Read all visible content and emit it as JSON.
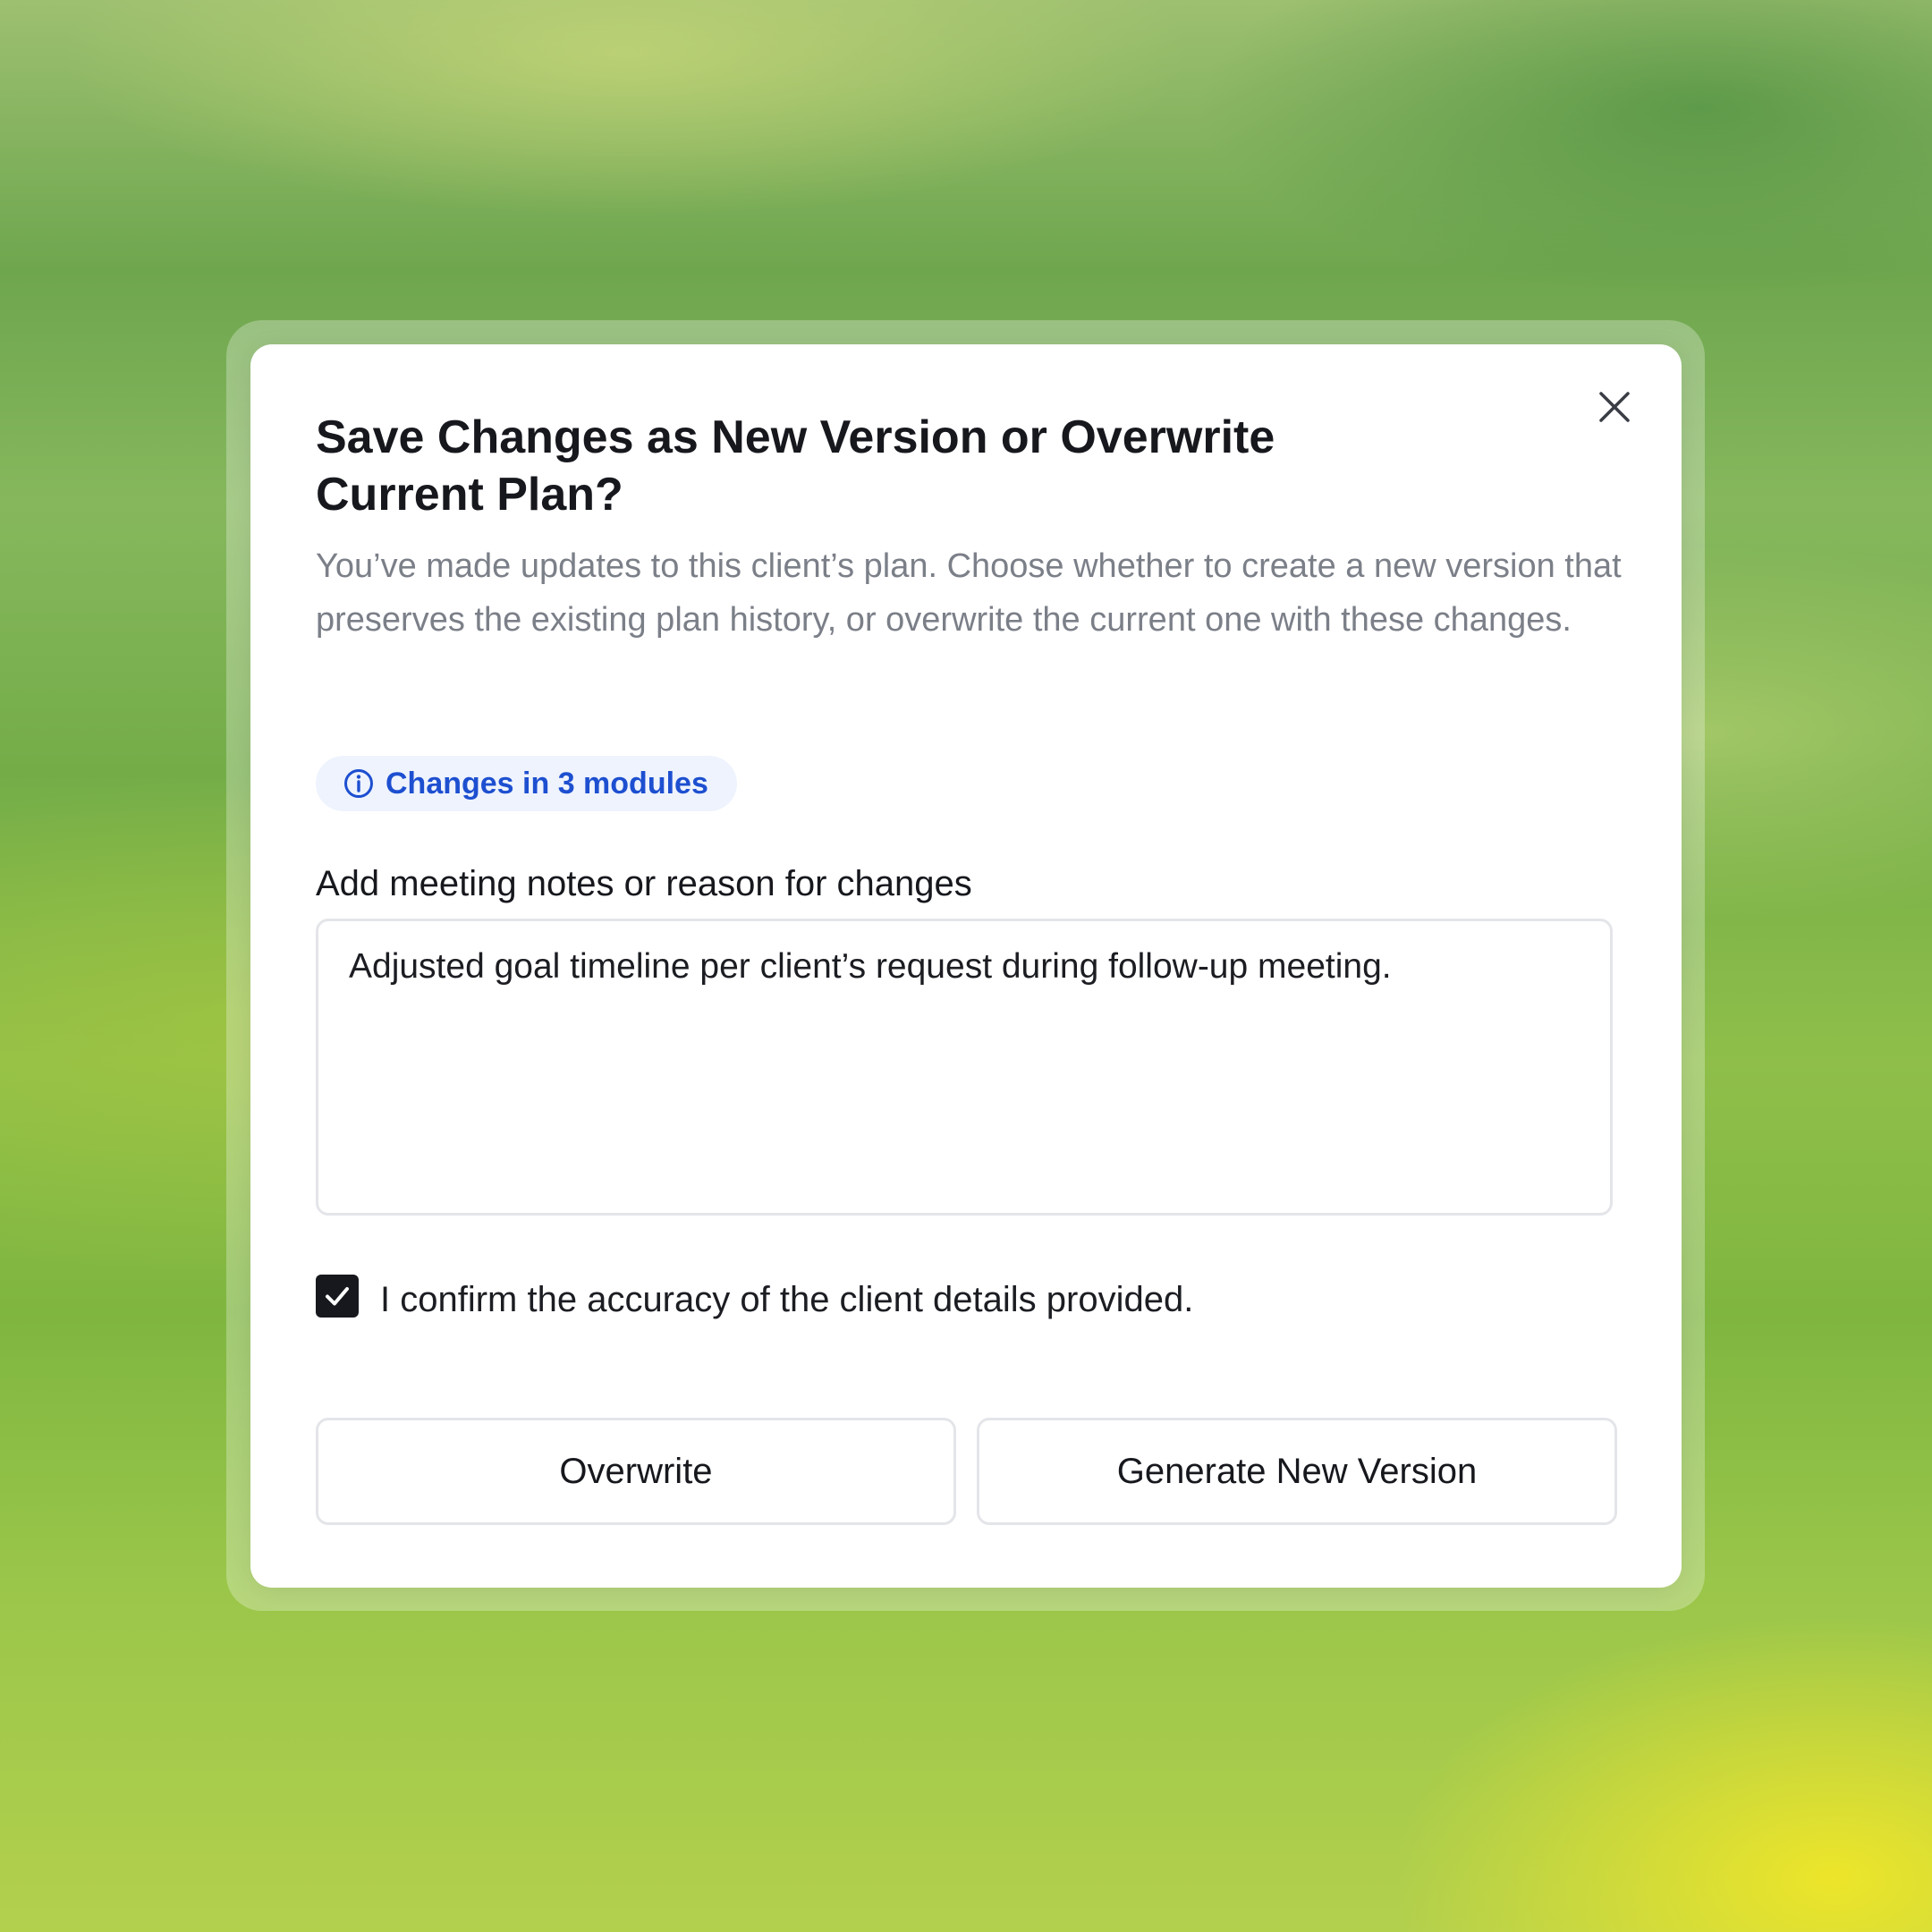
{
  "dialog": {
    "title": "Save Changes as New Version or Overwrite Current Plan?",
    "description": "You’ve made updates to this client’s plan. Choose whether to create a new version that preserves the existing plan history, or overwrite the current one with these changes.",
    "close_icon": "close-icon",
    "badge": {
      "icon": "info-circle-icon",
      "text": "Changes in 3 modules",
      "color": "#1d4fd0",
      "background": "#eef3fd"
    },
    "notes": {
      "label": "Add meeting notes or reason for changes",
      "value": "Adjusted goal timeline per client’s request during follow-up meeting."
    },
    "confirm": {
      "checked": true,
      "label": "I confirm the accuracy of the client details provided."
    },
    "buttons": {
      "overwrite_label": "Overwrite",
      "generate_label": "Generate New Version"
    }
  }
}
